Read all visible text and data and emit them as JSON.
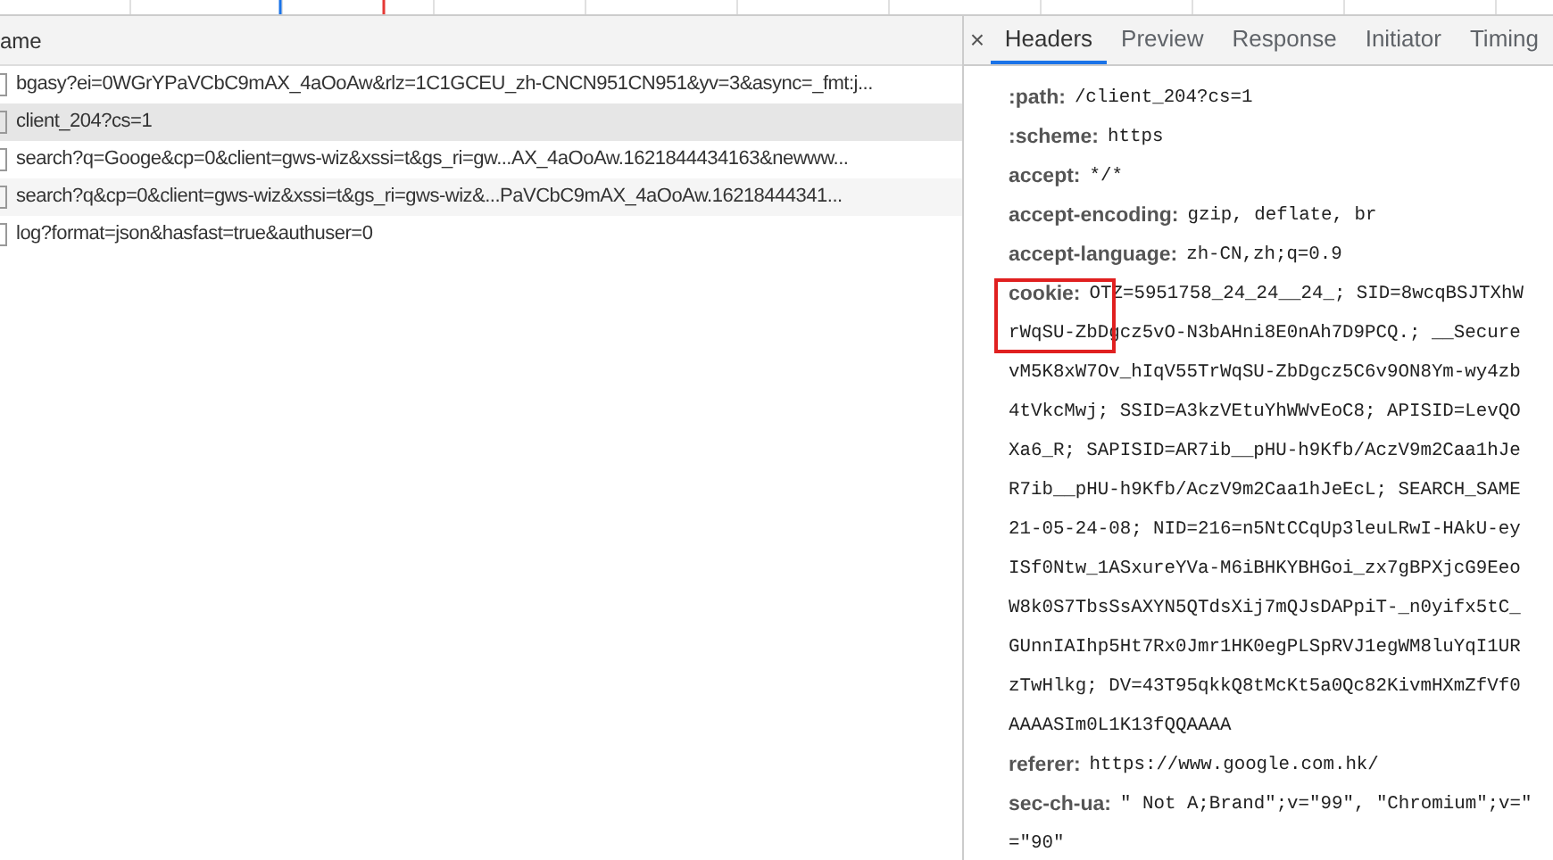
{
  "requests": {
    "column_header": "ame",
    "rows": [
      {
        "name": "bgasy?ei=0WGrYPaVCbC9mAX_4aOoAw&rlz=1C1GCEU_zh-CNCN951CN951&yv=3&async=_fmt:j...",
        "selected": false
      },
      {
        "name": "client_204?cs=1",
        "selected": true
      },
      {
        "name": "search?q=Googe&cp=0&client=gws-wiz&xssi=t&gs_ri=gw...AX_4aOoAw.1621844434163&newww...",
        "selected": false
      },
      {
        "name": "search?q&cp=0&client=gws-wiz&xssi=t&gs_ri=gws-wiz&...PaVCbC9mAX_4aOoAw.16218444341...",
        "selected": false
      },
      {
        "name": "log?format=json&hasfast=true&authuser=0",
        "selected": false
      }
    ]
  },
  "details": {
    "close": "×",
    "tabs": [
      {
        "label": "Headers",
        "selected": true
      },
      {
        "label": "Preview",
        "selected": false
      },
      {
        "label": "Response",
        "selected": false
      },
      {
        "label": "Initiator",
        "selected": false
      },
      {
        "label": "Timing",
        "selected": false
      }
    ],
    "headers": [
      {
        "name": ":path:",
        "lines": [
          "/client_204?cs=1"
        ],
        "highlighted": false
      },
      {
        "name": ":scheme:",
        "lines": [
          "https"
        ],
        "highlighted": false
      },
      {
        "name": "accept:",
        "lines": [
          "*/*"
        ],
        "highlighted": false
      },
      {
        "name": "accept-encoding:",
        "lines": [
          "gzip, deflate, br"
        ],
        "highlighted": false
      },
      {
        "name": "accept-language:",
        "lines": [
          "zh-CN,zh;q=0.9"
        ],
        "highlighted": false
      },
      {
        "name": "cookie:",
        "lines": [
          "OTZ=5951758_24_24__24_; SID=8wcqBSJTXhW",
          "rWqSU-ZbDgcz5vO-N3bAHni8E0nAh7D9PCQ.; __Secure",
          "vM5K8xW7Ov_hIqV55TrWqSU-ZbDgcz5C6v9ON8Ym-wy4zb",
          "4tVkcMwj; SSID=A3kzVEtuYhWWvEoC8; APISID=LevQO",
          "Xa6_R; SAPISID=AR7ib__pHU-h9Kfb/AczV9m2Caa1hJe",
          "R7ib__pHU-h9Kfb/AczV9m2Caa1hJeEcL; SEARCH_SAME",
          "21-05-24-08; NID=216=n5NtCCqUp3leuLRwI-HAkU-ey",
          "ISf0Ntw_1ASxureYVa-M6iBHKYBHGoi_zx7gBPXjcG9Eeo",
          "W8k0S7TbsSsAXYN5QTdsXij7mQJsDAPpiT-_n0yifx5tC_",
          "GUnnIAIhp5Ht7Rx0Jmr1HK0egPLSpRVJ1egWM8luYqI1UR",
          "zTwHlkg; DV=43T95qkkQ8tMcKt5a0Qc82KivmHXmZfVf0",
          "AAAASIm0L1K13fQQAAAA"
        ],
        "highlighted": true
      },
      {
        "name": "referer:",
        "lines": [
          "https://www.google.com.hk/"
        ],
        "highlighted": false
      },
      {
        "name": "sec-ch-ua:",
        "lines": [
          "\" Not A;Brand\";v=\"99\", \"Chromium\";v=\"",
          "=\"90\""
        ],
        "highlighted": false
      }
    ]
  }
}
